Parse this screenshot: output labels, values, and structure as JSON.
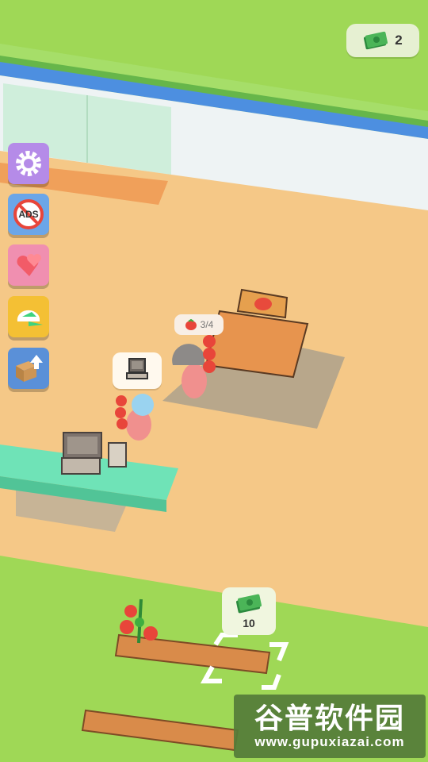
{
  "hud": {
    "money": "2"
  },
  "side_menu": [
    {
      "name": "settings-button",
      "icon": "gear-icon",
      "color": "#b58be8"
    },
    {
      "name": "no-ads-button",
      "icon": "no-ads-icon",
      "color": "#6ba6e8"
    },
    {
      "name": "hearts-button",
      "icon": "hearts-icon",
      "color": "#f08fb0"
    },
    {
      "name": "cap-button",
      "icon": "cap-icon",
      "color": "#f4c034"
    },
    {
      "name": "upgrade-box-button",
      "icon": "box-upgrade-icon",
      "color": "#5a90d8"
    }
  ],
  "ads_icon_text": "ADS",
  "player": {
    "carry_count": "3/4"
  },
  "unlock": {
    "price": "10"
  },
  "watermark": {
    "title": "谷普软件园",
    "url": "www.gupuxiazai.com"
  },
  "colors": {
    "grass": "#9fd856",
    "floor": "#f5c887",
    "counter": "#6fe3b7",
    "shelf": "#d98b4a"
  }
}
